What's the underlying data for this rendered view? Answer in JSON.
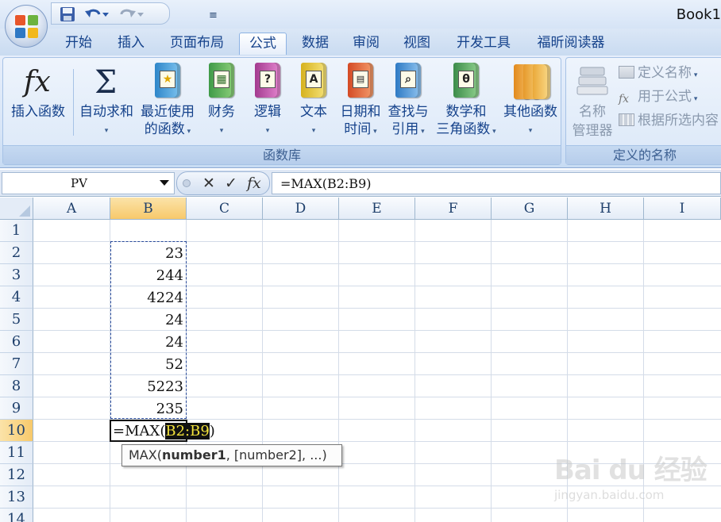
{
  "app": {
    "title": "Book1"
  },
  "qat": {
    "customize_glyph": "≡"
  },
  "tabs": [
    {
      "label": "开始",
      "active": false
    },
    {
      "label": "插入",
      "active": false
    },
    {
      "label": "页面布局",
      "active": false
    },
    {
      "label": "公式",
      "active": true
    },
    {
      "label": "数据",
      "active": false
    },
    {
      "label": "审阅",
      "active": false
    },
    {
      "label": "视图",
      "active": false
    },
    {
      "label": "开发工具",
      "active": false
    },
    {
      "label": "福昕阅读器",
      "active": false
    }
  ],
  "ribbon": {
    "function_library": {
      "label": "函数库",
      "insert_function": {
        "line1": "插入函数",
        "icon": "fx-icon"
      },
      "autosum": {
        "line1": "自动求和",
        "icon": "sigma-icon"
      },
      "recent": {
        "line1": "最近使用",
        "line2": "的函数",
        "icon": "star-book-icon"
      },
      "financial": {
        "line1": "财务",
        "icon": "money-book-icon"
      },
      "logical": {
        "line1": "逻辑",
        "icon": "question-book-icon",
        "glyph": "?"
      },
      "text": {
        "line1": "文本",
        "icon": "text-book-icon",
        "glyph": "A"
      },
      "datetime": {
        "line1": "日期和",
        "line2": "时间",
        "icon": "calendar-book-icon"
      },
      "lookup": {
        "line1": "查找与",
        "line2": "引用",
        "icon": "magnifier-book-icon"
      },
      "math": {
        "line1": "数学和",
        "line2": "三角函数",
        "icon": "theta-book-icon",
        "glyph": "θ"
      },
      "more": {
        "line1": "其他函数",
        "icon": "stacked-books-icon"
      }
    },
    "defined_names": {
      "label": "定义的名称",
      "name_manager": {
        "line1": "名称",
        "line2": "管理器",
        "icon": "name-manager-icon"
      },
      "define_name": "定义名称",
      "use_in_formula": "用于公式",
      "create_from_selection": "根据所选内容"
    }
  },
  "formula_bar": {
    "name_box": "PV",
    "cancel_glyph": "✕",
    "enter_glyph": "✓",
    "fx_glyph": "fx",
    "formula": "=MAX(B2:B9)"
  },
  "grid": {
    "columns": [
      "A",
      "B",
      "C",
      "D",
      "E",
      "F",
      "G",
      "H",
      "I"
    ],
    "selected_column": "B",
    "rows": [
      "1",
      "2",
      "3",
      "4",
      "5",
      "6",
      "7",
      "8",
      "9",
      "10",
      "11",
      "12",
      "13",
      "14"
    ],
    "selected_row": "10",
    "column_b_values": [
      "",
      "23",
      "244",
      "4224",
      "24",
      "24",
      "52",
      "5223",
      "235"
    ],
    "edit": {
      "prefix": "=MAX(",
      "ref": "B2:B9",
      "suffix": ")"
    },
    "tooltip": {
      "fn": "MAX(",
      "arg1": "number1",
      "rest": ", [number2], ...)"
    }
  },
  "watermark": {
    "logo": "Bai du 经验",
    "sub": "jingyan.baidu.com"
  },
  "colors": {
    "accent": "#15428b",
    "selected_header": "#f7c96b",
    "ref_highlight": "#f3e23b"
  }
}
